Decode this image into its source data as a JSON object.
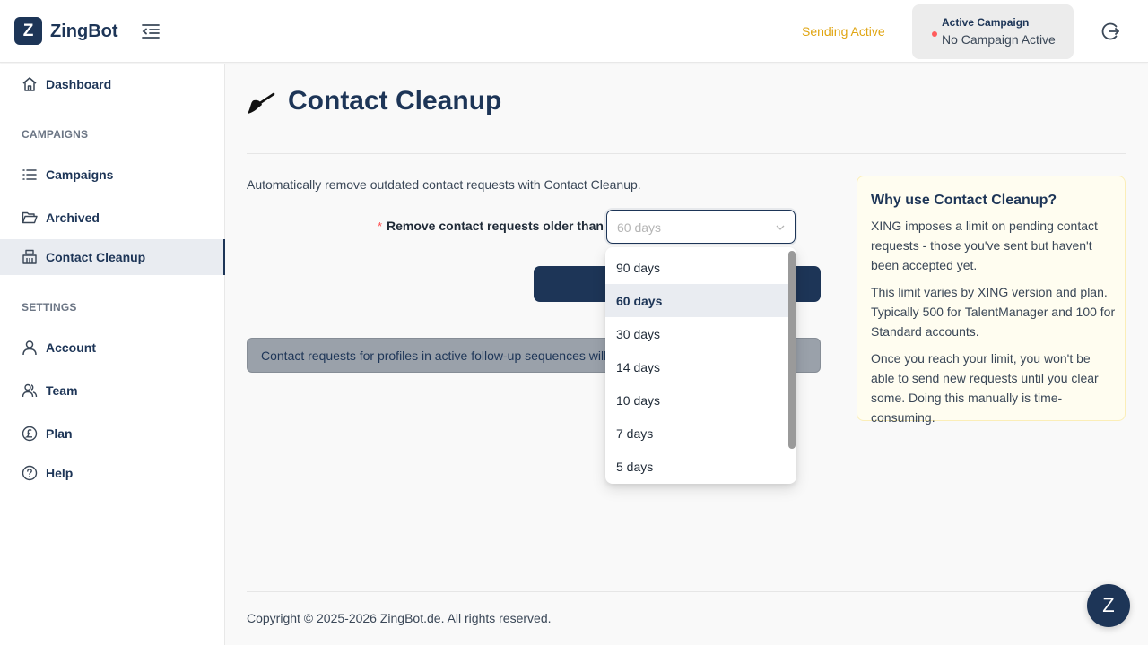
{
  "header": {
    "logo_letter": "Z",
    "brand": "ZingBot",
    "sending_status": "Sending Active",
    "campaign_title": "Active Campaign",
    "campaign_value": "No Campaign Active",
    "colors": {
      "brand": "#1d3557",
      "sending": "#e0a512",
      "inactive_dot": "#ff5c5c"
    }
  },
  "sidebar": {
    "dashboard": "Dashboard",
    "section_campaigns": "CAMPAIGNS",
    "campaigns": "Campaigns",
    "archived": "Archived",
    "contact_cleanup": "Contact Cleanup",
    "section_settings": "SETTINGS",
    "account": "Account",
    "team": "Team",
    "plan": "Plan",
    "help": "Help"
  },
  "main": {
    "title": "Contact Cleanup",
    "description": "Automatically remove outdated contact requests with Contact Cleanup.",
    "required_mark": "*",
    "field_label": "Remove contact requests older than :",
    "select_value": "60 days",
    "info_text": "Contact requests for profiles in active follow-up sequences will not be removed."
  },
  "dropdown": {
    "options": [
      "90 days",
      "60 days",
      "30 days",
      "14 days",
      "10 days",
      "7 days",
      "5 days"
    ],
    "selected": "60 days"
  },
  "why": {
    "title": "Why use Contact Cleanup?",
    "p1": "XING imposes a limit on pending contact requests - those you've sent but haven't been accepted yet.",
    "p2": "This limit varies by XING version and plan. Typically 500 for TalentManager and 100 for Standard accounts.",
    "p3": "Once you reach your limit, you won't be able to send new requests until you clear some. Doing this manually is time-consuming."
  },
  "footer": {
    "copyright": "Copyright © 2025-2026 ZingBot.de. All rights reserved.",
    "chat_letter": "Z"
  }
}
